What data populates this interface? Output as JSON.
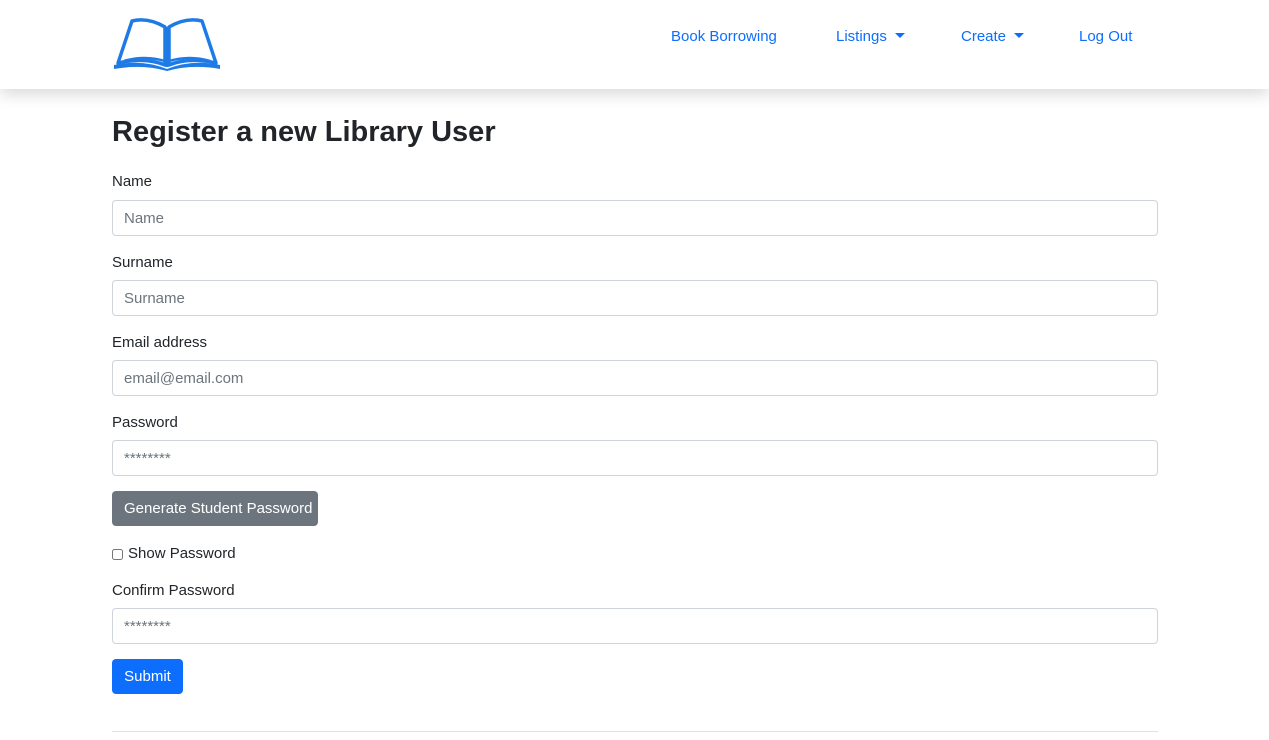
{
  "nav": {
    "logo_name": "open-book-logo",
    "links": [
      {
        "label": "Book Borrowing"
      },
      {
        "label": "Listings",
        "dropdown": true
      },
      {
        "label": "Create",
        "dropdown": true
      },
      {
        "label": "Log Out"
      }
    ]
  },
  "page": {
    "title": "Register a new Library User"
  },
  "form": {
    "name": {
      "label": "Name",
      "placeholder": "Name",
      "value": ""
    },
    "surname": {
      "label": "Surname",
      "placeholder": "Surname",
      "value": ""
    },
    "email": {
      "label": "Email address",
      "placeholder": "email@email.com",
      "value": ""
    },
    "password": {
      "label": "Password",
      "placeholder": "********",
      "value": ""
    },
    "generate_button": "Generate Student Password",
    "show_password": {
      "label": "Show Password",
      "checked": false
    },
    "confirm_password": {
      "label": "Confirm Password",
      "placeholder": "********",
      "value": ""
    },
    "submit_button": "Submit"
  },
  "colors": {
    "link": "#0d6efd",
    "primary": "#0d6efd",
    "secondary": "#6c757d",
    "text": "#212529",
    "border": "#ced4da",
    "logo": "#1e7be6"
  }
}
